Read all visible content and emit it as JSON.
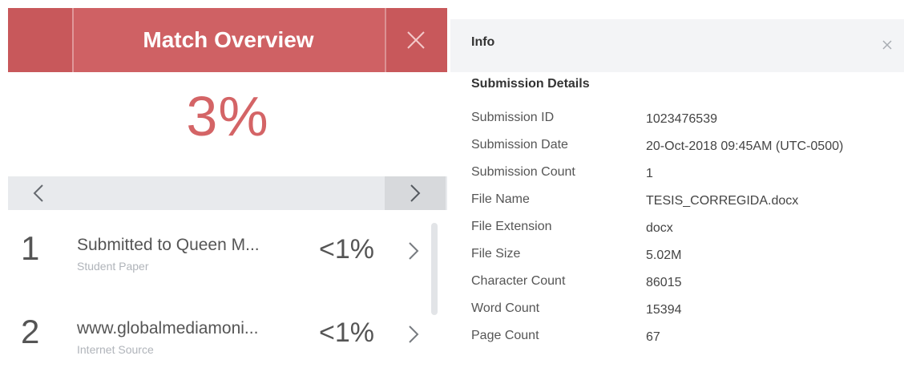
{
  "match_overview": {
    "title": "Match Overview",
    "overall_percent": "3%",
    "items": [
      {
        "number": "1",
        "source_title": "Submitted to Queen M...",
        "source_type": "Student Paper",
        "percent": "<1%"
      },
      {
        "number": "2",
        "source_title": "www.globalmediamoni...",
        "source_type": "Internet Source",
        "percent": "<1%"
      }
    ]
  },
  "info": {
    "title": "Info",
    "section_title": "Submission Details",
    "details": [
      {
        "label": "Submission ID",
        "value": "1023476539"
      },
      {
        "label": "Submission Date",
        "value": "20-Oct-2018 09:45AM (UTC-0500)"
      },
      {
        "label": "Submission Count",
        "value": "1"
      },
      {
        "label": "File Name",
        "value": "TESIS_CORREGIDA.docx"
      },
      {
        "label": "File Extension",
        "value": "docx"
      },
      {
        "label": "File Size",
        "value": "5.02M"
      },
      {
        "label": "Character Count",
        "value": "86015"
      },
      {
        "label": "Word Count",
        "value": "15394"
      },
      {
        "label": "Page Count",
        "value": "67"
      }
    ]
  },
  "icons": {
    "close": "close-icon",
    "prev": "chevron-left-icon",
    "next": "chevron-right-icon",
    "item_arrow": "chevron-right-icon"
  },
  "colors": {
    "header_red": "#cf6164",
    "percent_red": "#d46466",
    "nav_gray": "#e8eaed",
    "info_header_gray": "#f3f4f6"
  }
}
